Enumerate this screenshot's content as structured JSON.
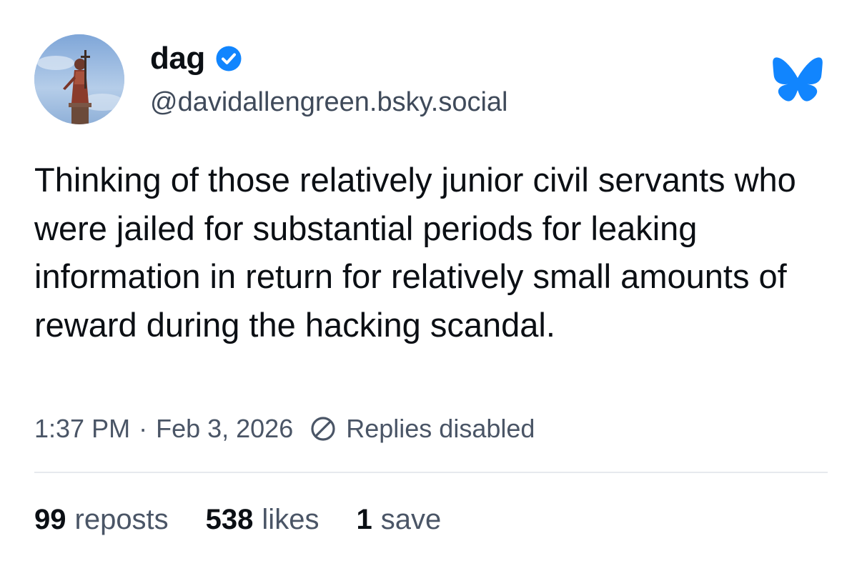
{
  "author": {
    "display_name": "dag",
    "handle": "@davidallengreen.bsky.social",
    "verified": true,
    "avatar_icon": "statue-avatar"
  },
  "post": {
    "text": "Thinking of those relatively junior civil servants who were jailed for substantial periods for leaking information in return for relatively small amounts of reward during the hacking scandal.",
    "time": "1:37 PM",
    "separator": "·",
    "date": "Feb 3, 2026",
    "replies_status": "Replies disabled"
  },
  "stats": {
    "reposts_count": "99",
    "reposts_label": "reposts",
    "likes_count": "538",
    "likes_label": "likes",
    "saves_count": "1",
    "saves_label": "save"
  },
  "icons": {
    "verified": "verified-check-icon",
    "brand": "bluesky-butterfly-icon",
    "replies": "ban-circle-icon"
  },
  "colors": {
    "brand_blue": "#1185fe",
    "text": "#0b0f14",
    "muted": "#4a5566",
    "divider": "#e6e9ee"
  }
}
